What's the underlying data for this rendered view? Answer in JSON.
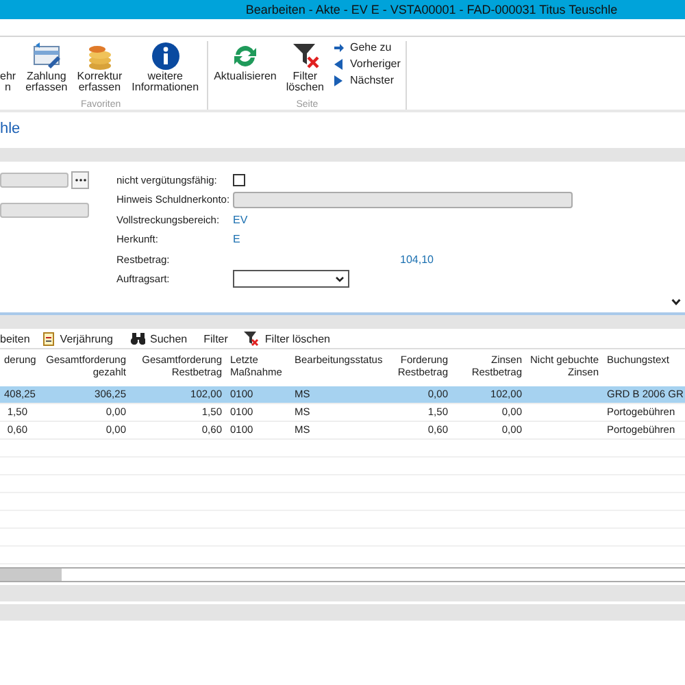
{
  "window": {
    "title": "Bearbeiten - Akte - EV E - VSTA00001 - FAD-000031 Titus Teuschle"
  },
  "ribbon": {
    "groups": [
      {
        "label": "Favoriten",
        "buttons": [
          {
            "kind": "none",
            "lines": [
              "ehr",
              "n"
            ]
          },
          {
            "kind": "payment",
            "lines": [
              "Zahlung",
              "erfassen"
            ]
          },
          {
            "kind": "coins",
            "lines": [
              "Korrektur",
              "erfassen"
            ]
          },
          {
            "kind": "info",
            "lines": [
              "weitere",
              "Informationen"
            ]
          }
        ]
      },
      {
        "label": "Seite",
        "buttons": [
          {
            "kind": "refresh",
            "lines": [
              "Aktualisieren"
            ]
          },
          {
            "kind": "filter-clear",
            "lines": [
              "Filter",
              "löschen"
            ]
          }
        ],
        "nav": [
          {
            "kind": "goto",
            "label": "Gehe zu"
          },
          {
            "kind": "prev",
            "label": "Vorheriger"
          },
          {
            "kind": "next",
            "label": "Nächster"
          }
        ]
      }
    ]
  },
  "heading": "hle",
  "form": {
    "left_fields": [
      {
        "kind": "lookup",
        "disabled": true
      },
      {
        "kind": "text",
        "disabled": true
      }
    ],
    "rows": [
      {
        "kind": "checkbox",
        "label": "nicht vergütungsfähig:",
        "checked": false
      },
      {
        "kind": "field",
        "label": "Hinweis Schuldnerkonto:",
        "disabled": true
      },
      {
        "kind": "value",
        "label": "Vollstreckungsbereich:",
        "value": "EV"
      },
      {
        "kind": "value",
        "label": "Herkunft:",
        "value": "E"
      },
      {
        "kind": "amount",
        "label": "Restbetrag:",
        "value": "104,10"
      },
      {
        "kind": "select",
        "label": "Auftragsart:"
      }
    ]
  },
  "toolbar": [
    {
      "kind": "text",
      "label": "beiten"
    },
    {
      "kind": "calendar",
      "label": "Verjährung"
    },
    {
      "kind": "binoculars",
      "label": "Suchen"
    },
    {
      "kind": "text",
      "label": "Filter"
    },
    {
      "kind": "filter-clear",
      "label": "Filter löschen"
    }
  ],
  "table": {
    "columns": [
      {
        "lines": [
          "derung"
        ]
      },
      {
        "lines": [
          "Gesamtforderung",
          "gezahlt"
        ]
      },
      {
        "lines": [
          "Gesamtforderung",
          "Restbetrag"
        ]
      },
      {
        "lines": [
          "Letzte",
          "Maßnahme"
        ]
      },
      {
        "lines": [
          "Bearbeitungsstatus"
        ]
      },
      {
        "lines": [
          "Forderung",
          "Restbetrag"
        ]
      },
      {
        "lines": [
          "Zinsen",
          "Restbetrag"
        ]
      },
      {
        "lines": [
          "Nicht gebuchte",
          "Zinsen"
        ]
      },
      {
        "lines": [
          "Buchungstext"
        ]
      }
    ],
    "rows": [
      {
        "selected": true,
        "cells": [
          "408,25",
          "306,25",
          "102,00",
          "0100",
          "MS",
          "0,00",
          "102,00",
          "",
          "GRD B 2006 GR"
        ]
      },
      {
        "selected": false,
        "cells": [
          "1,50",
          "0,00",
          "1,50",
          "0100",
          "MS",
          "1,50",
          "0,00",
          "",
          "Portogebühren"
        ]
      },
      {
        "selected": false,
        "cells": [
          "0,60",
          "0,00",
          "0,60",
          "0100",
          "MS",
          "0,60",
          "0,00",
          "",
          "Portogebühren"
        ]
      }
    ]
  }
}
